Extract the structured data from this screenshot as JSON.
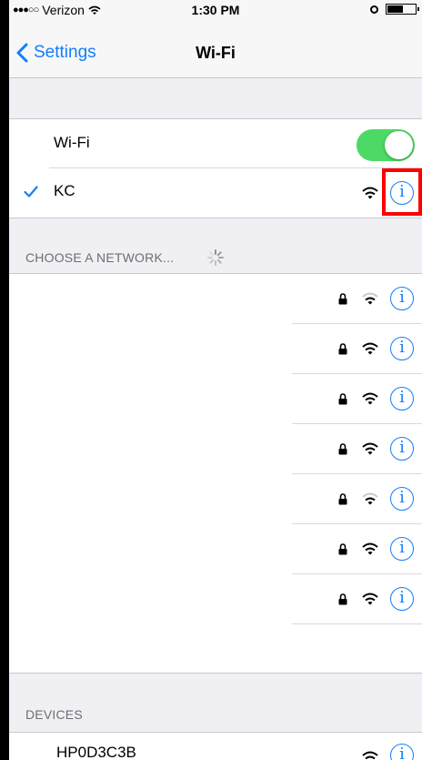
{
  "status_bar": {
    "carrier": "Verizon",
    "time": "1:30 PM",
    "battery_level": 0.55
  },
  "nav": {
    "back_label": "Settings",
    "title": "Wi-Fi"
  },
  "wifi_toggle": {
    "label": "Wi-Fi",
    "on": true
  },
  "connected": {
    "name": "KC"
  },
  "choose_section": {
    "header": "CHOOSE A NETWORK..."
  },
  "networks": [
    {
      "name": "",
      "locked": true,
      "signal": 2
    },
    {
      "name": "",
      "locked": true,
      "signal": 3
    },
    {
      "name": "",
      "locked": true,
      "signal": 3
    },
    {
      "name": "",
      "locked": true,
      "signal": 3
    },
    {
      "name": "",
      "locked": true,
      "signal": 2
    },
    {
      "name": "",
      "locked": true,
      "signal": 3
    },
    {
      "name": "",
      "locked": true,
      "signal": 3
    }
  ],
  "devices_section": {
    "header": "DEVICES",
    "items": [
      {
        "name": "HP0D3C3B"
      }
    ]
  },
  "colors": {
    "accent": "#147efb",
    "toggle_on": "#4cd964",
    "highlight": "#ff0000"
  }
}
